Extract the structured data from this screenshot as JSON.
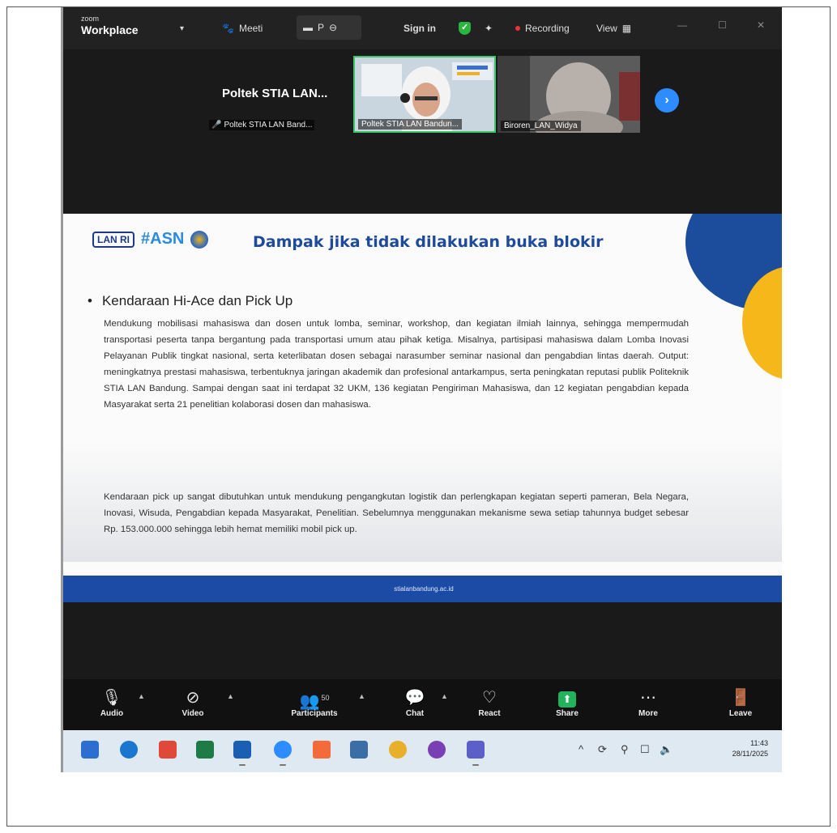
{
  "titlebar": {
    "brand_small": "zoom",
    "brand_name": "Workplace",
    "meeting_label": "Meeti",
    "tab_label": "P",
    "signin_label": "Sign in",
    "recording_label": "Recording",
    "view_label": "View"
  },
  "videos": {
    "main_name": "Poltek STIA LAN...",
    "main_caption": "Poltek STIA LAN Band...",
    "tile1_label": "Poltek STIA LAN Bandun...",
    "tile2_label": "Biroren_LAN_Widya"
  },
  "slide": {
    "logo_lan": "LAN RI",
    "logo_asn": "#ASN",
    "title": "Dampak jika tidak dilakukan buka blokir",
    "bullet": "Kendaraan Hi-Ace dan Pick Up",
    "paragraph1": "Mendukung mobilisasi mahasiswa dan dosen untuk lomba, seminar, workshop, dan kegiatan ilmiah lainnya, sehingga mempermudah transportasi peserta tanpa bergantung pada transportasi umum atau pihak ketiga. Misalnya, partisipasi mahasiswa dalam Lomba Inovasi Pelayanan Publik tingkat nasional, serta keterlibatan dosen sebagai narasumber seminar nasional dan pengabdian lintas daerah. Output: meningkatnya prestasi mahasiswa, terbentuknya jaringan akademik dan profesional antarkampus, serta peningkatan reputasi publik Politeknik STIA LAN Bandung. Sampai dengan saat ini terdapat 32 UKM, 136 kegiatan Pengiriman Mahasiswa, dan 12 kegiatan pengabdian kepada Masyarakat serta 21 penelitian kolaborasi dosen dan mahasiswa.",
    "paragraph2": "Kendaraan pick up sangat dibutuhkan untuk mendukung pengangkutan logistik dan perlengkapan kegiatan seperti pameran, Bela Negara, Inovasi, Wisuda, Pengabdian kepada Masyarakat, Penelitian. Sebelumnya menggunakan mekanisme sewa setiap tahunnya budget sebesar Rp. 153.000.000 sehingga lebih hemat memiliki mobil pick up.",
    "footer": "stialanbandung.ac.id"
  },
  "toolbar": {
    "audio": "Audio",
    "video": "Video",
    "participants": "Participants",
    "participant_count": "50",
    "chat": "Chat",
    "react": "React",
    "share": "Share",
    "more": "More",
    "leave": "Leave"
  },
  "taskbar": {
    "time": "11:43",
    "date": "28/11/2025"
  },
  "colors": {
    "zoom_blue": "#2d8cff",
    "share_green": "#23b35c",
    "slide_blue": "#1c4ba5",
    "slide_yellow": "#f6b71b"
  }
}
